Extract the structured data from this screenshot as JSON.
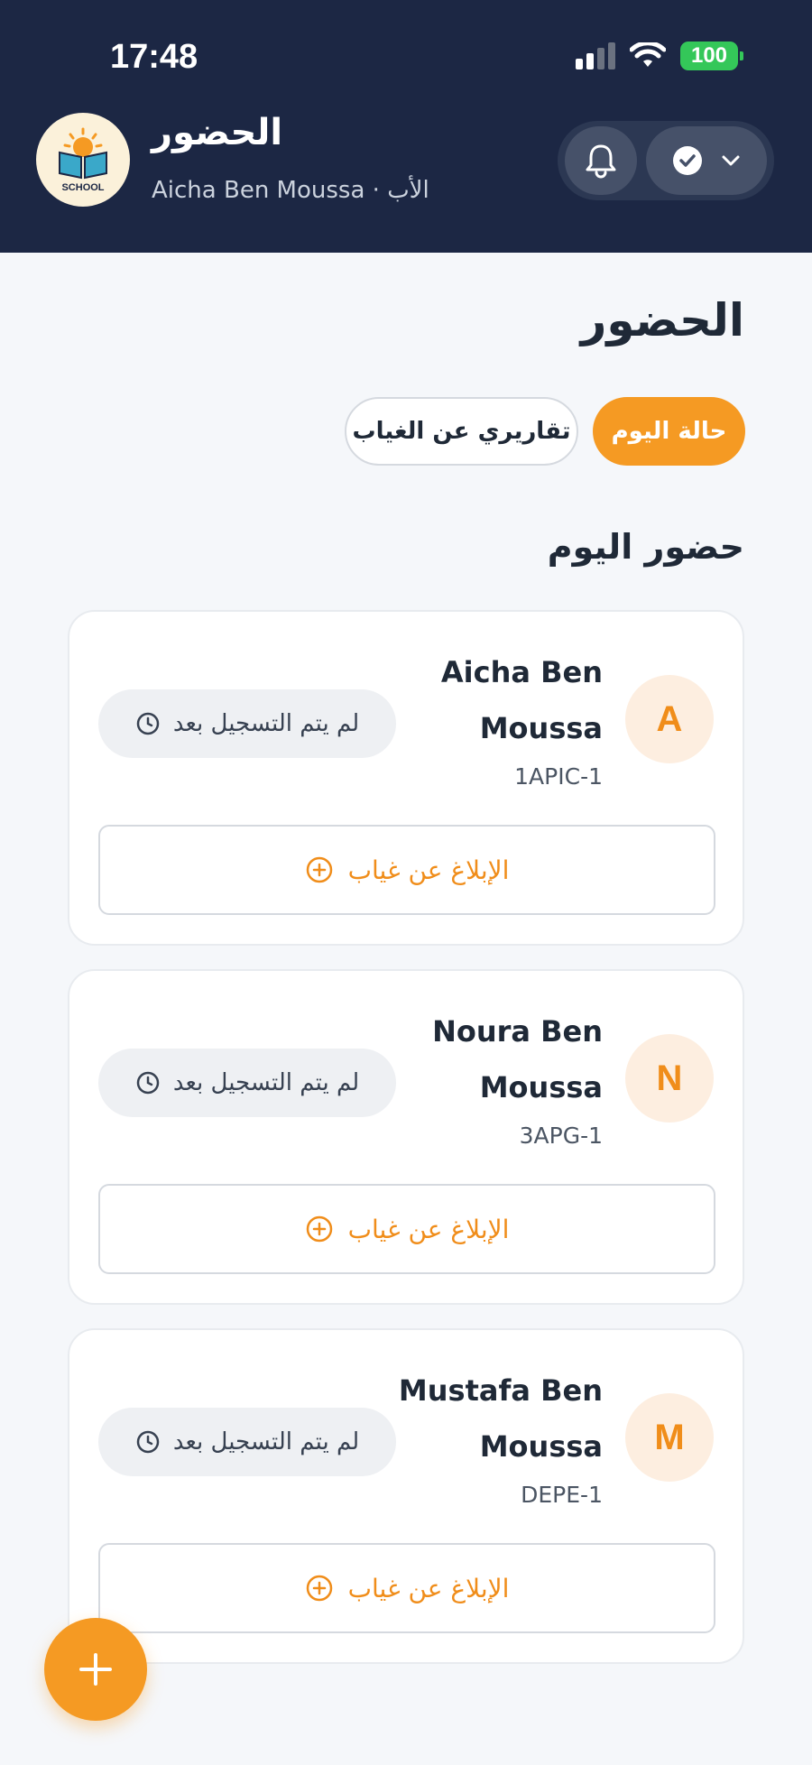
{
  "status_bar": {
    "time": "17:48",
    "battery": "100"
  },
  "header": {
    "title": "الحضور",
    "subtitle": "Aicha Ben Moussa · الأب",
    "logo_text": "SCHOOL"
  },
  "page": {
    "title": "الحضور",
    "tabs": [
      {
        "label": "حالة اليوم",
        "active": true
      },
      {
        "label": "تقاريري عن الغياب",
        "active": false
      }
    ],
    "section_title": "حضور اليوم"
  },
  "students": [
    {
      "initial": "A",
      "name": "Aicha Ben Moussa",
      "class": "1APIC-1",
      "status": "لم يتم التسجيل بعد",
      "report_label": "الإبلاغ عن غياب"
    },
    {
      "initial": "N",
      "name": "Noura Ben Moussa",
      "class": "3APG-1",
      "status": "لم يتم التسجيل بعد",
      "report_label": "الإبلاغ عن غياب"
    },
    {
      "initial": "M",
      "name": "Mustafa Ben Moussa",
      "class": "DEPE-1",
      "status": "لم يتم التسجيل بعد",
      "report_label": "الإبلاغ عن غياب"
    }
  ],
  "colors": {
    "header_bg": "#1c2744",
    "accent": "#f59a23",
    "page_bg": "#f5f7fa"
  },
  "icons": {
    "bell": "bell-icon",
    "check": "check-circle-icon",
    "chevron": "chevron-down-icon",
    "clock": "clock-icon",
    "plus_circle": "plus-circle-icon",
    "fab": "plus-icon"
  }
}
